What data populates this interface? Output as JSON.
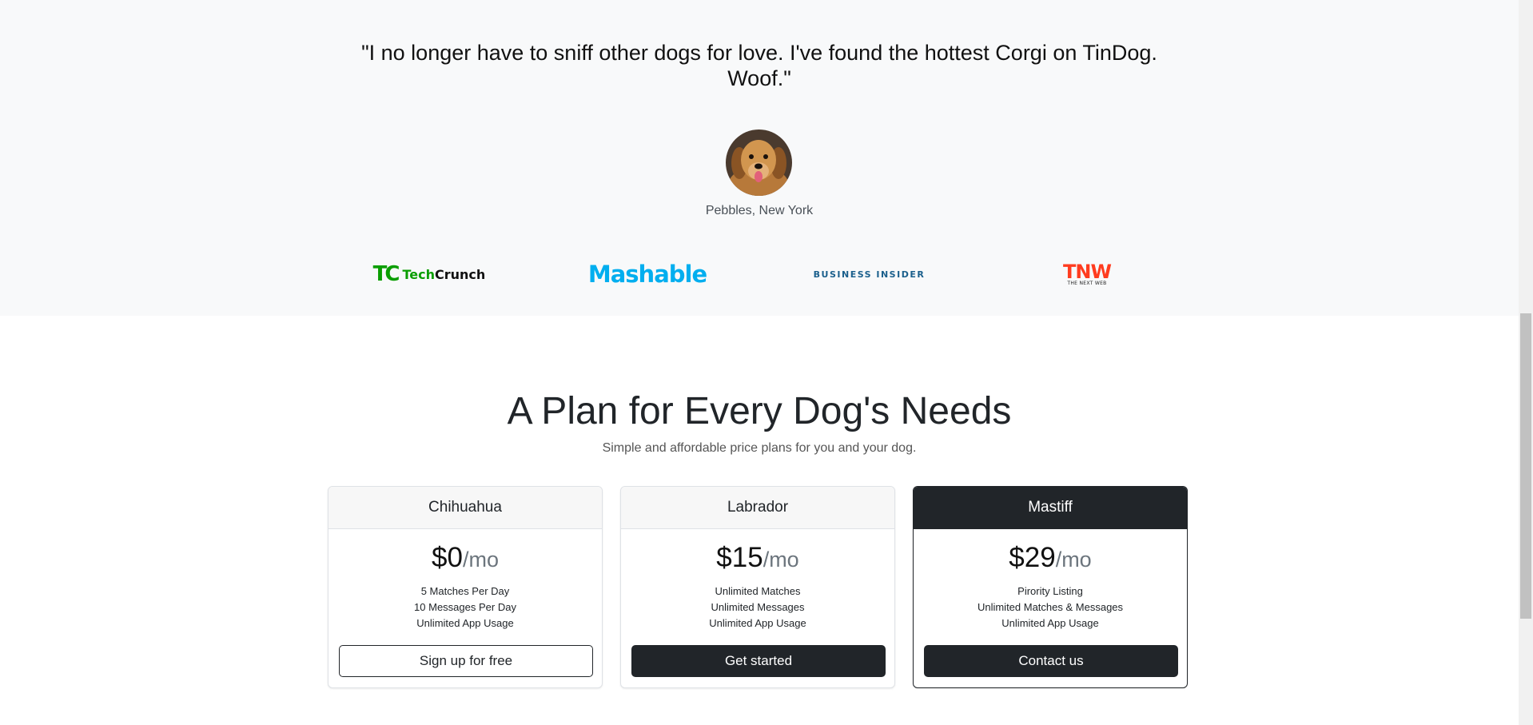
{
  "testimonial": {
    "quote": "\"I no longer have to sniff other dogs for love. I've found the hottest Corgi on TinDog. Woof.\"",
    "author": "Pebbles, New York",
    "avatar_icon": "golden-retriever-photo"
  },
  "press": {
    "techcrunch": {
      "mark": "TC",
      "word_a": "Tech",
      "word_b": "Crunch"
    },
    "mashable": "Mashable",
    "business_insider": "BUSINESS INSIDER",
    "tnw": {
      "big": "TNW",
      "small": "THE NEXT WEB"
    }
  },
  "pricing": {
    "title": "A Plan for Every Dog's Needs",
    "subtitle": "Simple and affordable price plans for you and your dog.",
    "plans": [
      {
        "name": "Chihuahua",
        "price": "$0",
        "period": "/mo",
        "features": [
          "5 Matches Per Day",
          "10 Messages Per Day",
          "Unlimited App Usage"
        ],
        "cta": "Sign up for free"
      },
      {
        "name": "Labrador",
        "price": "$15",
        "period": "/mo",
        "features": [
          "Unlimited Matches",
          "Unlimited Messages",
          "Unlimited App Usage"
        ],
        "cta": "Get started"
      },
      {
        "name": "Mastiff",
        "price": "$29",
        "period": "/mo",
        "features": [
          "Pirority Listing",
          "Unlimited Matches & Messages",
          "Unlimited App Usage"
        ],
        "cta": "Contact us"
      }
    ]
  },
  "colors": {
    "section_bg": "#f8f9fa",
    "dark": "#212529",
    "techcrunch_green": "#0a9e01",
    "mashable_blue": "#00aeef",
    "business_insider_blue": "#1a5f8c",
    "tnw_red": "#ff3c1f"
  }
}
